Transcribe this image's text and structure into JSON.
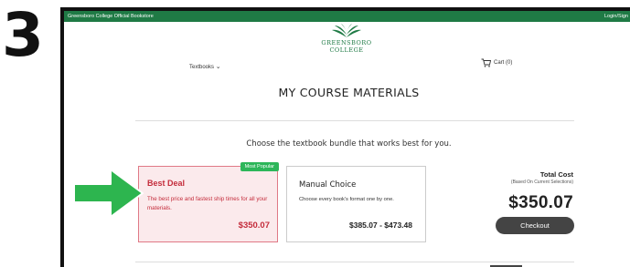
{
  "step_number": "3",
  "topbar": {
    "store_name": "Greensboro College Official Bookstore",
    "login": "Login/Sign"
  },
  "logo": {
    "line1": "GREENSBORO",
    "line2": "COLLEGE",
    "icon": "book-leaf-logo",
    "color": "#1f7a45"
  },
  "nav": {
    "textbooks_label": "Textbooks",
    "cart_label": "Cart (0)"
  },
  "page_title": "MY COURSE MATERIALS",
  "subtitle": "Choose the textbook bundle that works best for you.",
  "best_deal": {
    "badge": "Most Popular",
    "title": "Best Deal",
    "description": "The best price and fastest ship times for all your materials.",
    "price": "$350.07"
  },
  "manual_choice": {
    "title": "Manual Choice",
    "description": "Choose every book's format one by one.",
    "price": "$385.07 - $473.48"
  },
  "total": {
    "label": "Total Cost",
    "sublabel": "(Based On Current Selections)",
    "amount": "$350.07",
    "checkout_label": "Checkout"
  },
  "colors": {
    "brand_green": "#1f7a45",
    "badge_green": "#2db65a",
    "deal_red": "#c42c3b",
    "arrow_green": "#2db54f"
  }
}
